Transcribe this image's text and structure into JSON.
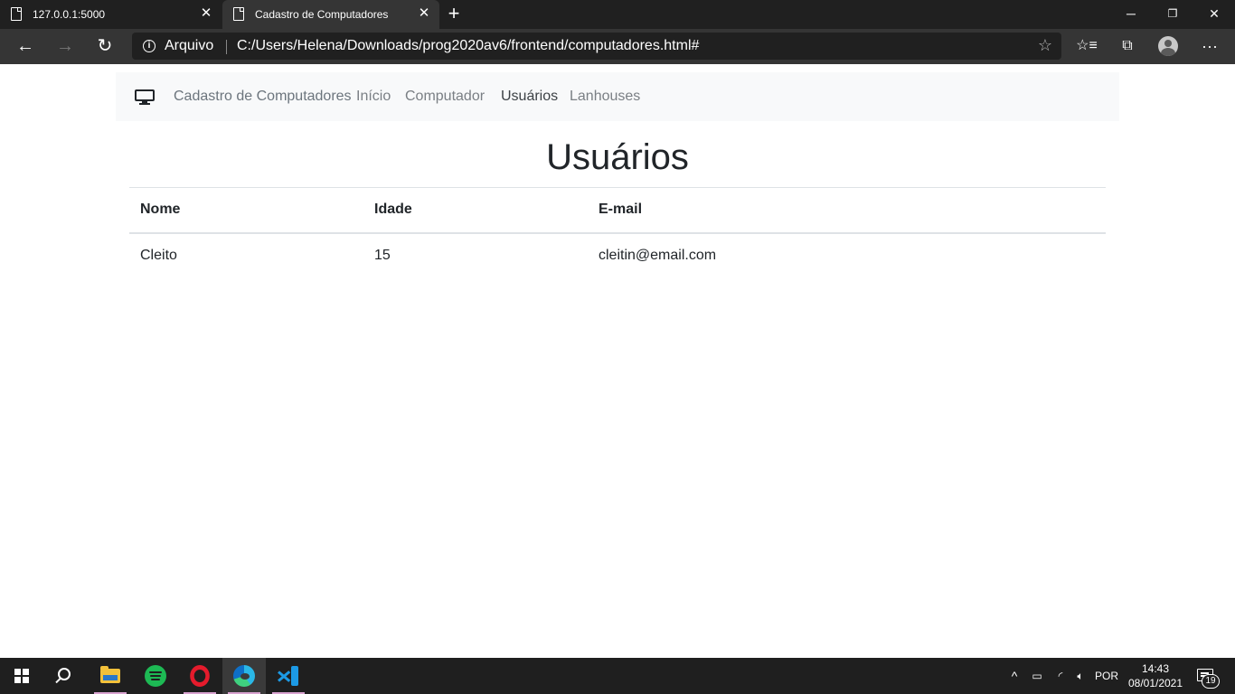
{
  "browser": {
    "tabs": [
      {
        "title": "127.0.0.1:5000"
      },
      {
        "title": "Cadastro de Computadores"
      }
    ],
    "new_tab_glyph": "+",
    "window_controls": {
      "minimize": "─",
      "maximize": "❐",
      "close": "✕"
    },
    "nav": {
      "back": "←",
      "forward": "→",
      "refresh": "↻"
    },
    "address": {
      "scheme_label": "Arquivo",
      "url": "C:/Users/Helena/Downloads/prog2020av6/frontend/computadores.html#"
    },
    "icons": [
      "back-icon",
      "forward-icon",
      "refresh-icon",
      "info-icon",
      "favorite-star-icon",
      "favorites-list-icon",
      "collections-icon",
      "profile-avatar-icon",
      "more-menu-icon"
    ]
  },
  "navbar": {
    "brand": "Cadastro de Computadores",
    "links": [
      {
        "label": "Início",
        "active": false
      },
      {
        "label": "Computador",
        "active": false
      },
      {
        "label": "Usuários",
        "active": true
      },
      {
        "label": "Lanhouses",
        "active": false
      }
    ]
  },
  "page": {
    "title": "Usuários",
    "table": {
      "columns": [
        "Nome",
        "Idade",
        "E-mail"
      ],
      "rows": [
        [
          "Cleito",
          "15",
          "cleitin@email.com"
        ]
      ]
    }
  },
  "taskbar": {
    "apps": [
      "start-icon",
      "search-icon",
      "file-explorer-icon",
      "spotify-icon",
      "opera-icon",
      "edge-icon",
      "vscode-icon"
    ],
    "tray": {
      "language": "POR",
      "time": "14:43",
      "date": "08/01/2021",
      "notification_count": "19"
    }
  },
  "colors": {
    "titlebar": "#202020",
    "toolbar": "#353535",
    "navbar_bg": "#f8f9fa",
    "text_muted": "#6c757d",
    "text_dark": "#212529",
    "taskbar": "#1f1f1f"
  }
}
